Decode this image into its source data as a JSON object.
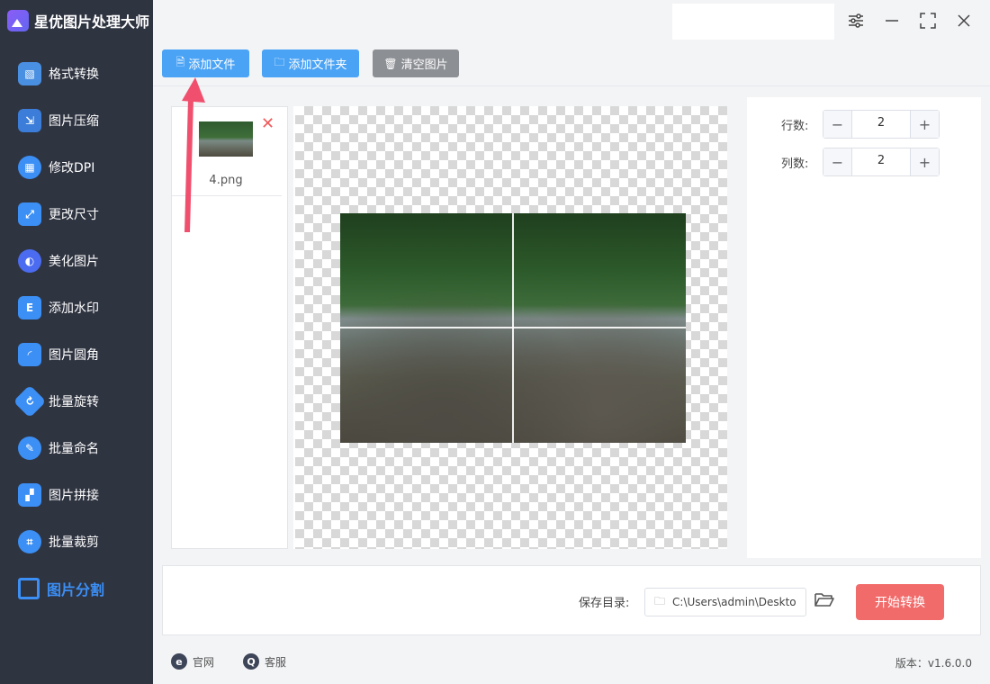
{
  "app": {
    "title": "星优图片处理大师"
  },
  "sidebar": {
    "items": [
      {
        "label": "格式转换",
        "icon": "image-icon",
        "color": "#4a90e2"
      },
      {
        "label": "图片压缩",
        "icon": "compress-icon",
        "color": "#3b7dd8"
      },
      {
        "label": "修改DPI",
        "icon": "dpi-icon",
        "color": "#3b8ff5"
      },
      {
        "label": "更改尺寸",
        "icon": "resize-icon",
        "color": "#3b8ff5"
      },
      {
        "label": "美化图片",
        "icon": "beautify-icon",
        "color": "#4b6cf0"
      },
      {
        "label": "添加水印",
        "icon": "watermark-icon",
        "color": "#3b8ff5"
      },
      {
        "label": "图片圆角",
        "icon": "round-corner-icon",
        "color": "#3b8ff5"
      },
      {
        "label": "批量旋转",
        "icon": "rotate-icon",
        "color": "#3b8ff5"
      },
      {
        "label": "批量命名",
        "icon": "rename-icon",
        "color": "#3b8ff5"
      },
      {
        "label": "图片拼接",
        "icon": "puzzle-icon",
        "color": "#3b8ff5"
      },
      {
        "label": "批量裁剪",
        "icon": "crop-icon",
        "color": "#3b8ff5"
      },
      {
        "label": "图片分割",
        "icon": "split-icon",
        "color": "#3b8ff5",
        "active": true
      }
    ]
  },
  "toolbar": {
    "add_file": "添加文件",
    "add_folder": "添加文件夹",
    "clear": "清空图片"
  },
  "files": [
    {
      "name": "4.png"
    }
  ],
  "settings": {
    "rows_label": "行数:",
    "rows_value": "2",
    "cols_label": "列数:",
    "cols_value": "2"
  },
  "save": {
    "label": "保存目录:",
    "path": "C:\\Users\\admin\\Deskto",
    "start_button": "开始转换"
  },
  "footer": {
    "website": "官网",
    "support": "客服",
    "version": "版本：v1.6.0.0"
  },
  "colors": {
    "sidebar_bg": "#2f3441",
    "accent_blue": "#4aa3f5",
    "start_red": "#f26b6b",
    "annotation_red": "#f0506e"
  }
}
